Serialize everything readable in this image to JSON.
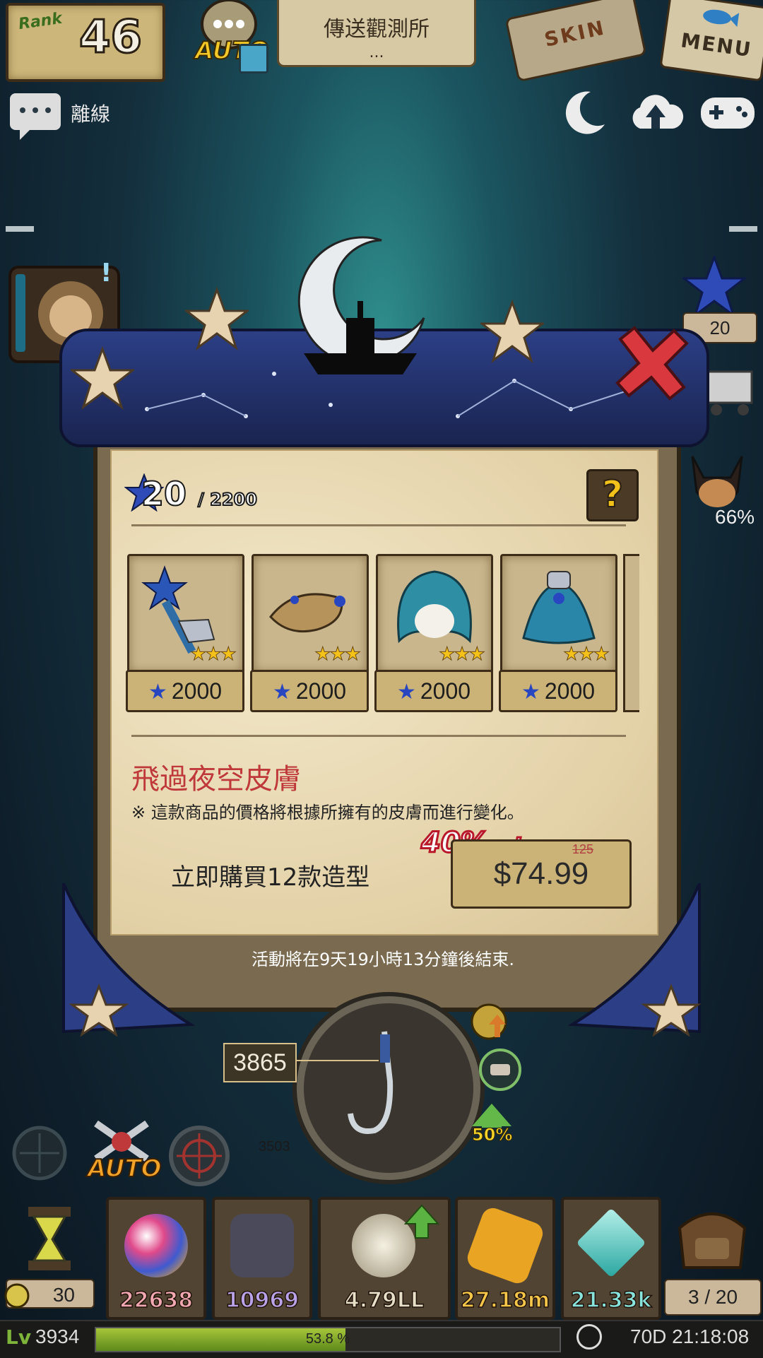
{
  "top_bar": {
    "rank_label": "Rank",
    "rank_value": "46",
    "auto_label": "AUTO",
    "location_name": "傳送觀測所",
    "location_sub": "...",
    "skin_label": "SKIN",
    "menu_label": "MENU"
  },
  "status": {
    "chat_status": "離線",
    "icons": [
      "chat-icon",
      "moon-icon",
      "cloud-upload-icon",
      "gamepad-icon"
    ]
  },
  "side": {
    "star_count": "20",
    "boss_percent": "66%"
  },
  "popup": {
    "current_stars": "20",
    "star_separator": "/",
    "max_stars": "2200",
    "help_label": "?",
    "items": [
      {
        "price": "2000",
        "icon": "star-wand-icon"
      },
      {
        "price": "2000",
        "icon": "braided-headband-icon"
      },
      {
        "price": "2000",
        "icon": "blue-hair-icon"
      },
      {
        "price": "2000",
        "icon": "blue-cape-icon"
      }
    ],
    "title": "飛過夜空皮膚",
    "note": "※ 這款商品的價格將根據所擁有的皮膚而進行變化。",
    "sale_percent": "40%",
    "sale_word": "sale",
    "original_price": "125",
    "buy_label": "立即購買12款造型",
    "price": "$74.99",
    "timer_text": "活動將在9天19小時13分鐘後結束."
  },
  "fishing": {
    "depth_current": "3865",
    "depth_marker": "3503",
    "boost": "50%",
    "auto_label": "AUTO"
  },
  "resources": [
    {
      "value": "22638",
      "color": "#f1a8b0",
      "icon": "rainbow-orb-icon"
    },
    {
      "value": "10969",
      "color": "#b9a2e8",
      "icon": "dark-crest-icon"
    },
    {
      "value": "4.79LL",
      "color": "#e7dfc7",
      "icon": "shell-icon"
    },
    {
      "value": "27.18m",
      "color": "#f5c64a",
      "icon": "gold-ore-icon"
    },
    {
      "value": "21.33k",
      "color": "#88e3dd",
      "icon": "crystal-icon"
    }
  ],
  "hourglass_count": "30",
  "bag_count": "3 / 20",
  "bottom": {
    "level_icon": "Lv",
    "level": "3934",
    "xp_percent_label": "53.8 %",
    "xp_percent": 53.8,
    "time": "70D 21:18:08"
  }
}
